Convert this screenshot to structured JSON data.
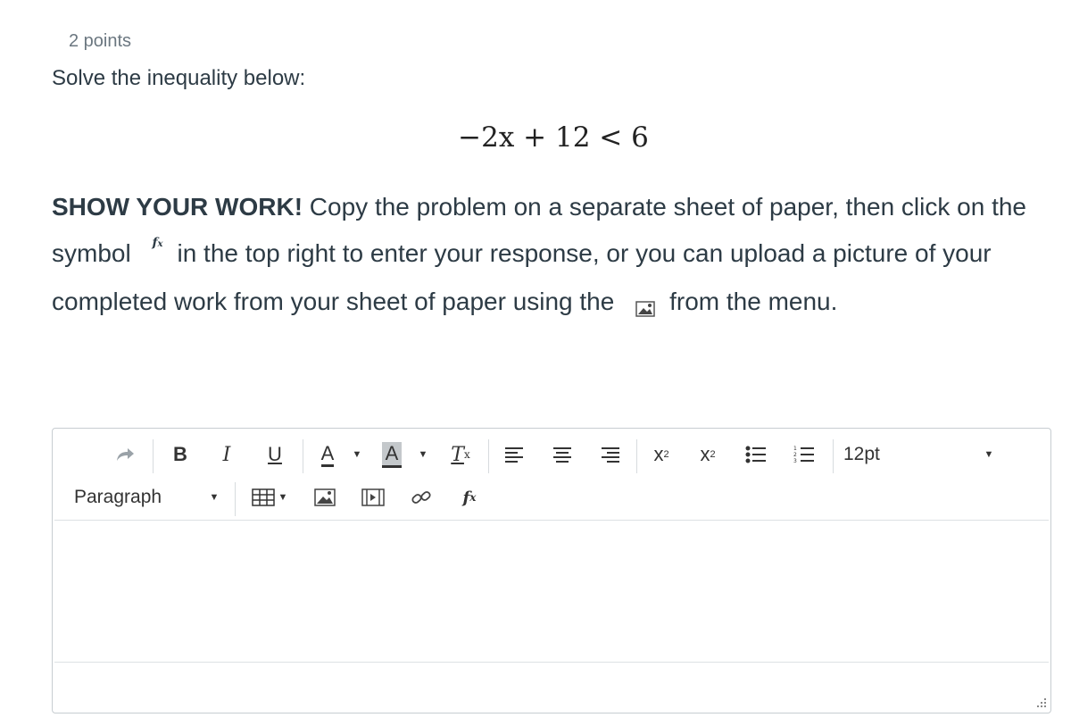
{
  "question": {
    "points": "2 points",
    "prompt": "Solve the inequality below:",
    "equation": "−2x + 12 < 6",
    "instructions": {
      "bold": "SHOW YOUR WORK!",
      "part1": " Copy the problem on a separate sheet of paper, then click on the symbol",
      "part2": "in the top right to enter your response, or you can upload a picture of your completed work from your sheet of paper using the",
      "part3": "from the menu."
    },
    "inline_icons": [
      "fx-icon",
      "image-icon"
    ]
  },
  "editor": {
    "toolbar_row1": {
      "items": [
        "redo",
        "bold",
        "italic",
        "underline",
        "text-color",
        "background-color",
        "clear-formatting",
        "align-left",
        "align-center",
        "align-right",
        "superscript",
        "subscript",
        "bullet-list",
        "numbered-list",
        "font-size"
      ],
      "font_size": "12pt"
    },
    "toolbar_row2": {
      "items": [
        "format-select",
        "table",
        "image",
        "media",
        "link",
        "equation"
      ],
      "format": "Paragraph"
    },
    "content": ""
  }
}
